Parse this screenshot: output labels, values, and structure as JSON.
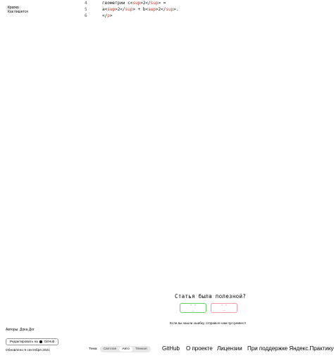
{
  "sidebar": {
    "tags": [
      "Кратко",
      "Как пишется"
    ]
  },
  "code": {
    "lines": [
      {
        "num": "4",
        "parts": [
          {
            "t": "геометрии c<",
            "red": false
          },
          {
            "t": "sup",
            "red": true
          },
          {
            "t": ">2</",
            "red": false
          },
          {
            "t": "sup",
            "red": true
          },
          {
            "t": "> =",
            "red": false
          }
        ]
      },
      {
        "num": "5",
        "parts": [
          {
            "t": "a<",
            "red": false
          },
          {
            "t": "sup",
            "red": true
          },
          {
            "t": ">2</",
            "red": false
          },
          {
            "t": "sup",
            "red": true
          },
          {
            "t": "> + b<",
            "red": false
          },
          {
            "t": "sup",
            "red": true
          },
          {
            "t": ">2</",
            "red": false
          },
          {
            "t": "sup",
            "red": true
          },
          {
            "t": ">.",
            "red": false
          }
        ]
      },
      {
        "num": "6",
        "parts": [
          {
            "t": "</",
            "red": false
          },
          {
            "t": "p",
            "red": true
          },
          {
            "t": ">",
            "red": false
          }
        ]
      }
    ]
  },
  "feedback": {
    "title": "Статья была полезной?",
    "yes_face": "^ ^",
    "yes_mouth": "‿",
    "no_face": "° °",
    "no_mouth": "︵",
    "note": "Если вы нашли ошибку, отправьте нам пул-реквест!"
  },
  "meta": {
    "authors": "Авторы: Дока Дог",
    "edit_label_prefix": "Редактировать на",
    "edit_label_suffix": "GitHub",
    "updated": "Обновлено 9 сентября 2021"
  },
  "theme": {
    "label": "Тема:",
    "options": [
      "Светлая",
      "Авто",
      "Тёмная"
    ],
    "active_index": 1
  },
  "footer": {
    "links": [
      "GitHub",
      "О проекте",
      "Лицензии",
      "При поддержке Яндекс.Практикума"
    ]
  },
  "colors": {
    "code_tag": "#d0382b",
    "yes_border": "#5fd55f",
    "no_border": "#f09aae"
  }
}
